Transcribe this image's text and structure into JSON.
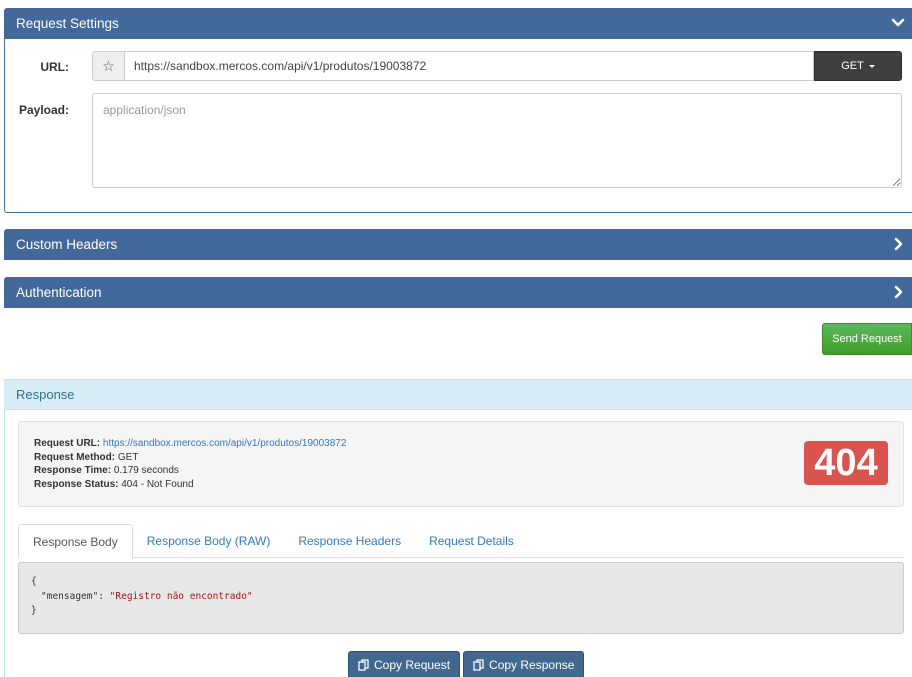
{
  "request_settings": {
    "title": "Request Settings",
    "url_label": "URL:",
    "url_value": "https://sandbox.mercos.com/api/v1/produtos/19003872",
    "method": "GET",
    "payload_label": "Payload:",
    "payload_placeholder": "application/json"
  },
  "custom_headers": {
    "title": "Custom Headers"
  },
  "authentication": {
    "title": "Authentication"
  },
  "send_button": "Send Request",
  "response": {
    "title": "Response",
    "summary": {
      "request_url_label": "Request URL:",
      "request_url": "https://sandbox.mercos.com/api/v1/produtos/19003872",
      "method_label": "Request Method:",
      "method": "GET",
      "time_label": "Response Time:",
      "time": "0.179 seconds",
      "status_label": "Response Status:",
      "status": "404 - Not Found"
    },
    "status_code": "404",
    "tabs": [
      {
        "label": "Response Body"
      },
      {
        "label": "Response Body (RAW)"
      },
      {
        "label": "Response Headers"
      },
      {
        "label": "Request Details"
      }
    ],
    "body": {
      "open": "{",
      "key": "\"mensagem\"",
      "colon": ": ",
      "value": "\"Registro não encontrado\"",
      "close": "}"
    },
    "copy_request": "Copy Request",
    "copy_response": "Copy Response"
  },
  "icons": {
    "collapse": "chevron-down-icon",
    "expand": "chevron-right-icon",
    "favorite": "star-icon",
    "copy": "copy-icon"
  },
  "colors": {
    "panel_header": "#43699b",
    "send_green": "#3f9e2a",
    "status_red": "#d9534f",
    "response_header": "#d9edf7"
  }
}
